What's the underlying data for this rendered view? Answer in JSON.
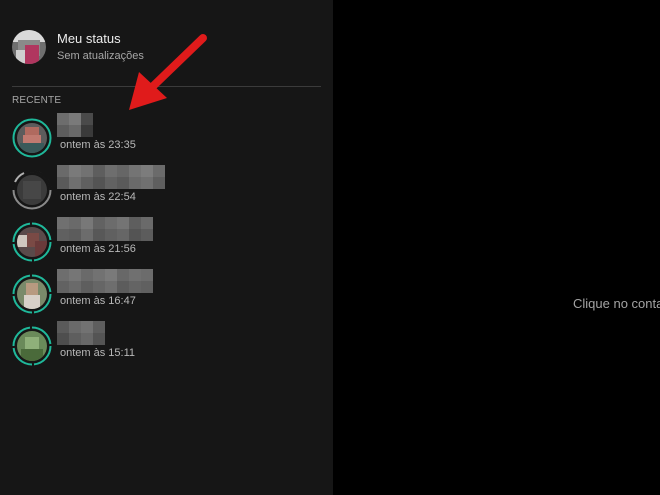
{
  "my_status": {
    "title": "Meu status",
    "subtitle": "Sem atualizações"
  },
  "recent": {
    "label": "RECENTE",
    "items": [
      {
        "time": "ontem às 23:35"
      },
      {
        "time": "ontem às 22:54"
      },
      {
        "time": "ontem às 21:56"
      },
      {
        "time": "ontem às 16:47"
      },
      {
        "time": "ontem às 15:11"
      }
    ]
  },
  "main": {
    "message": "Clique no conta"
  },
  "colors": {
    "ring_unseen": "#1fb89a",
    "ring_seen": "#8a8a8a",
    "arrow": "#e01b1b"
  }
}
